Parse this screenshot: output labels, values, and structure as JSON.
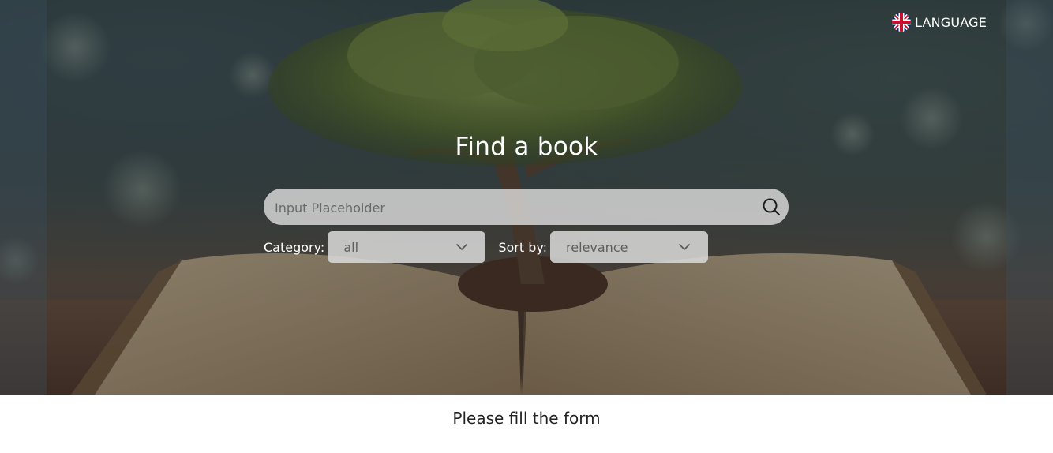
{
  "header": {
    "language_label": "LANGUAGE",
    "language_icon": "uk-flag-icon"
  },
  "hero": {
    "title": "Find a book",
    "background_image": "open-book-with-tree-photo"
  },
  "search": {
    "placeholder": "Input Placeholder",
    "value": "",
    "icon": "search-icon"
  },
  "filters": {
    "category_label": "Category:",
    "category_value": "all",
    "sort_label": "Sort by:",
    "sort_value": "relevance",
    "dropdown_icon": "chevron-down-icon"
  },
  "status": {
    "message": "Please fill the form"
  },
  "colors": {
    "overlay_text": "#ffffff",
    "field_background": "#dcdcdc",
    "message_text": "#222222"
  }
}
